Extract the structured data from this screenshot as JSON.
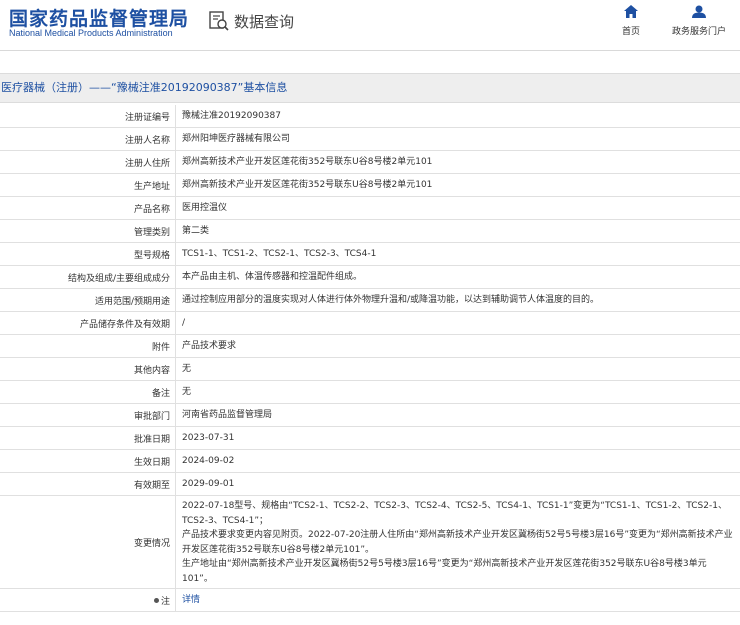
{
  "header": {
    "logo_cn": "国家药品监督管理局",
    "logo_en": "National Medical Products Administration",
    "query_label": "数据查询",
    "nav": [
      {
        "label": "首页",
        "icon": "home-icon"
      },
      {
        "label": "政务服务门户",
        "icon": "user-icon"
      }
    ]
  },
  "title_bar": "医疗器械（注册）——“豫械注准20192090387”基本信息",
  "colors": {
    "brand": "#1e50a2",
    "title_bg": "#eeeeee",
    "border": "#e0e0e0"
  },
  "rows": [
    {
      "label": "注册证编号",
      "value": "豫械注准20192090387"
    },
    {
      "label": "注册人名称",
      "value": "郑州阳坤医疗器械有限公司"
    },
    {
      "label": "注册人住所",
      "value": "郑州高新技术产业开发区莲花街352号联东U谷8号楼2单元101"
    },
    {
      "label": "生产地址",
      "value": "郑州高新技术产业开发区莲花街352号联东U谷8号楼2单元101"
    },
    {
      "label": "产品名称",
      "value": "医用控温仪"
    },
    {
      "label": "管理类别",
      "value": "第二类"
    },
    {
      "label": "型号规格",
      "value": "TCS1-1、TCS1-2、TCS2-1、TCS2-3、TCS4-1"
    },
    {
      "label": "结构及组成/主要组成成分",
      "value": "本产品由主机、体温传感器和控温配件组成。"
    },
    {
      "label": "适用范围/预期用途",
      "value": "通过控制应用部分的温度实现对人体进行体外物理升温和/或降温功能，以达到辅助调节人体温度的目的。"
    },
    {
      "label": "产品储存条件及有效期",
      "value": "/"
    },
    {
      "label": "附件",
      "value": "产品技术要求"
    },
    {
      "label": "其他内容",
      "value": "无"
    },
    {
      "label": "备注",
      "value": "无"
    },
    {
      "label": "审批部门",
      "value": "河南省药品监督管理局"
    },
    {
      "label": "批准日期",
      "value": "2023-07-31"
    },
    {
      "label": "生效日期",
      "value": "2024-09-02"
    },
    {
      "label": "有效期至",
      "value": "2029-09-01"
    }
  ],
  "change_row": {
    "label": "变更情况",
    "lines": [
      "2022-07-18型号、规格由“TCS2-1、TCS2-2、TCS2-3、TCS2-4、TCS2-5、TCS4-1、TCS1-1”变更为“TCS1-1、TCS1-2、TCS2-1、TCS2-3、TCS4-1”；",
      "产品技术要求变更内容见附页。2022-07-20注册人住所由“郑州高新技术产业开发区冀杨街52号5号楼3层16号”变更为“郑州高新技术产业开发区莲花街352号联东U谷8号楼2单元101”。",
      "生产地址由“郑州高新技术产业开发区冀杨街52号5号楼3层16号”变更为“郑州高新技术产业开发区莲花街352号联东U谷8号楼3单元101”。"
    ]
  },
  "note_row": {
    "label": "注",
    "link": "详情"
  }
}
